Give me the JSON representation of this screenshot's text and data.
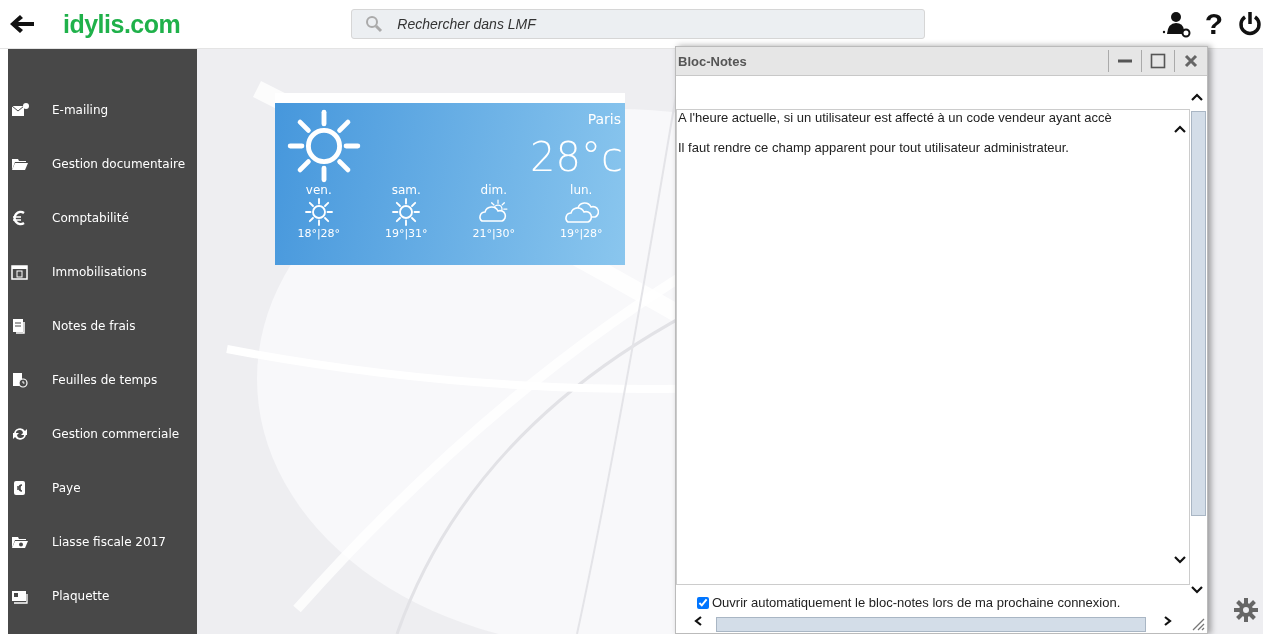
{
  "header": {
    "logo": "idylis.com",
    "search": {
      "placeholder": "Rechercher dans LMF"
    },
    "help_label": "?"
  },
  "sidebar": {
    "items": [
      {
        "label": "E-mailing"
      },
      {
        "label": "Gestion documentaire"
      },
      {
        "label": "Comptabilité"
      },
      {
        "label": "Immobilisations"
      },
      {
        "label": "Notes de frais"
      },
      {
        "label": "Feuilles de temps"
      },
      {
        "label": "Gestion commerciale"
      },
      {
        "label": "Paye"
      },
      {
        "label": "Liasse fiscale 2017"
      },
      {
        "label": "Plaquette"
      }
    ]
  },
  "weather": {
    "city": "Paris",
    "temperature": "28°c",
    "kind": "sun",
    "days": [
      {
        "day": "ven.",
        "kind": "sun",
        "range": "18°|28°"
      },
      {
        "day": "sam.",
        "kind": "sun",
        "range": "19°|31°"
      },
      {
        "day": "dim.",
        "kind": "partly-cloudy",
        "range": "21°|30°"
      },
      {
        "day": "lun.",
        "kind": "cloudy",
        "range": "19°|28°"
      }
    ]
  },
  "notepad": {
    "title": "Bloc-Notes",
    "lines": [
      "A l'heure actuelle, si un utilisateur est affecté à un code vendeur ayant accè",
      "Il faut rendre ce champ apparent pour tout utilisateur administrateur."
    ],
    "open_on_login": {
      "label": "Ouvrir automatiquement le bloc-notes lors de ma prochaine connexion.",
      "checked": true
    }
  }
}
